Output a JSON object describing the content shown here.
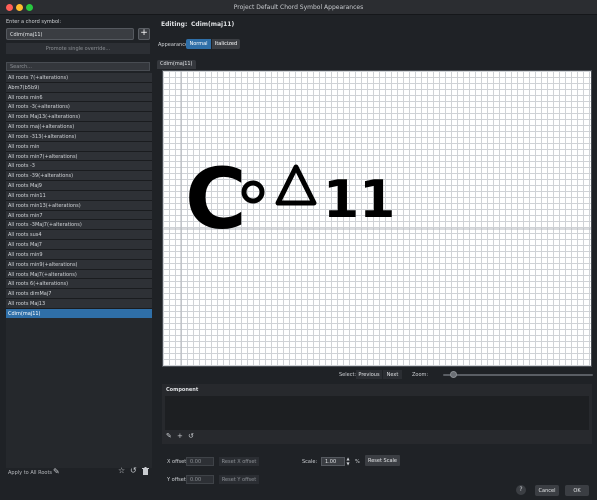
{
  "window": {
    "title": "Project Default Chord Symbol Appearances",
    "traffic_lights": [
      "#ff5f57",
      "#febc2e",
      "#28c840"
    ]
  },
  "left": {
    "prompt_label": "Enter a chord symbol:",
    "chord_input_value": "Cdim(maj11)",
    "add_button_label": "+",
    "promote_button_label": "Promote single override...",
    "search_placeholder": "Search...",
    "items": [
      "All roots 7(+alterations)",
      "Abm7(b5b9)",
      "All roots min6",
      "All roots -3(+alterations)",
      "All roots Maj13(+alterations)",
      "All roots maj(+alterations)",
      "All roots -313(+alterations)",
      "All roots min",
      "All roots min7(+alterations)",
      "All roots -3",
      "All roots -39(+alterations)",
      "All roots Maj9",
      "All roots min11",
      "All roots min13(+alterations)",
      "All roots min7",
      "All roots -3Maj7(+alterations)",
      "All roots sus4",
      "All roots Maj7",
      "All roots min9",
      "All roots min9(+alterations)",
      "All roots Maj7(+alterations)",
      "All roots 6(+alterations)",
      "All roots dimMaj7",
      "All roots Maj13",
      "Cdim(maj11)"
    ],
    "selected_index": 24,
    "apply_all_label": "Apply to All Roots"
  },
  "right": {
    "editing_label": "Editing:",
    "editing_value": "Cdim(maj11)",
    "appearance_label": "Appearance:",
    "tabs": [
      "Normal",
      "Italicized"
    ],
    "active_tab": 0,
    "canvas_tab_label": "Cdim(maj11)",
    "canvas_glyphs": {
      "root": "C",
      "extension": "11"
    },
    "select_label": "Select:",
    "previous_label": "Previous",
    "next_label": "Next",
    "zoom_label": "Zoom:",
    "zoom_level": 0.07,
    "component_title": "Component",
    "x_offset_label": "X offset:",
    "x_offset_value": "0.00",
    "reset_x_label": "Reset X offset",
    "y_offset_label": "Y offset:",
    "y_offset_value": "0.00",
    "reset_y_label": "Reset Y offset",
    "scale_label": "Scale:",
    "scale_value": "1.00",
    "scale_unit": "%",
    "reset_scale_label": "Reset Scale",
    "help_label": "?",
    "cancel_label": "Cancel",
    "ok_label": "OK"
  },
  "colors": {
    "accent": "#2f6fa8",
    "background": "#1f2226"
  }
}
